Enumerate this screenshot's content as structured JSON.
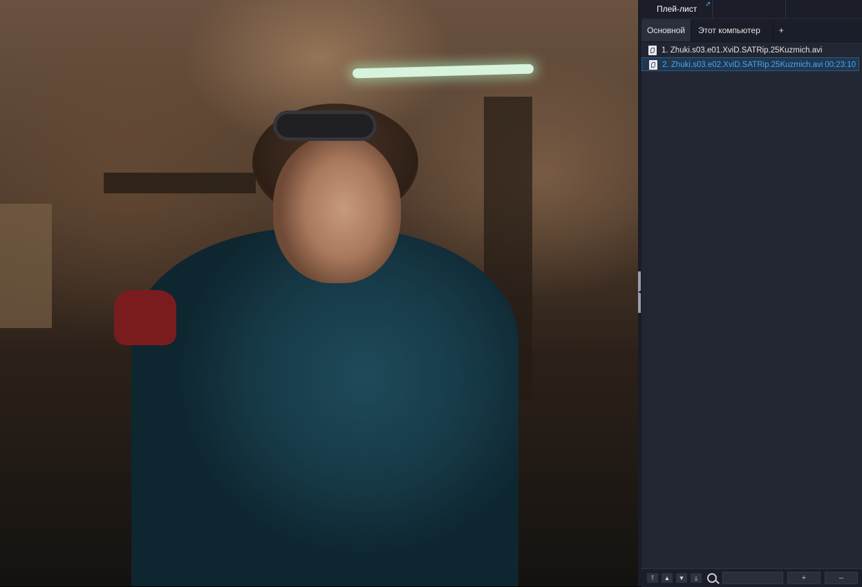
{
  "playlist": {
    "title": "Плей-лист",
    "tabs": [
      {
        "label": "Основной",
        "active": true
      },
      {
        "label": "Этот компьютер",
        "active": false
      },
      {
        "label": "+",
        "active": false
      }
    ],
    "items": [
      {
        "title": "1. Zhuki.s03.e01.XviD.SATRip.25Kuzmich.avi",
        "duration": "",
        "selected": false
      },
      {
        "title": "2. Zhuki.s03.e02.XviD.SATRip.25Kuzmich.avi",
        "duration": "00:23:10",
        "selected": true
      }
    ],
    "footer": {
      "search_placeholder": "",
      "add_label": "+",
      "remove_label": "–"
    }
  },
  "icons": {
    "external_window": "external-link-icon",
    "file": "file-icon",
    "move_top": "move-top-icon",
    "move_up": "move-up-icon",
    "move_down": "move-down-icon",
    "move_bottom": "move-bottom-icon",
    "search": "search-icon"
  },
  "colors": {
    "panel_bg": "#222532",
    "selected_text": "#4aa6f0",
    "accent_link": "#62a9ea"
  }
}
